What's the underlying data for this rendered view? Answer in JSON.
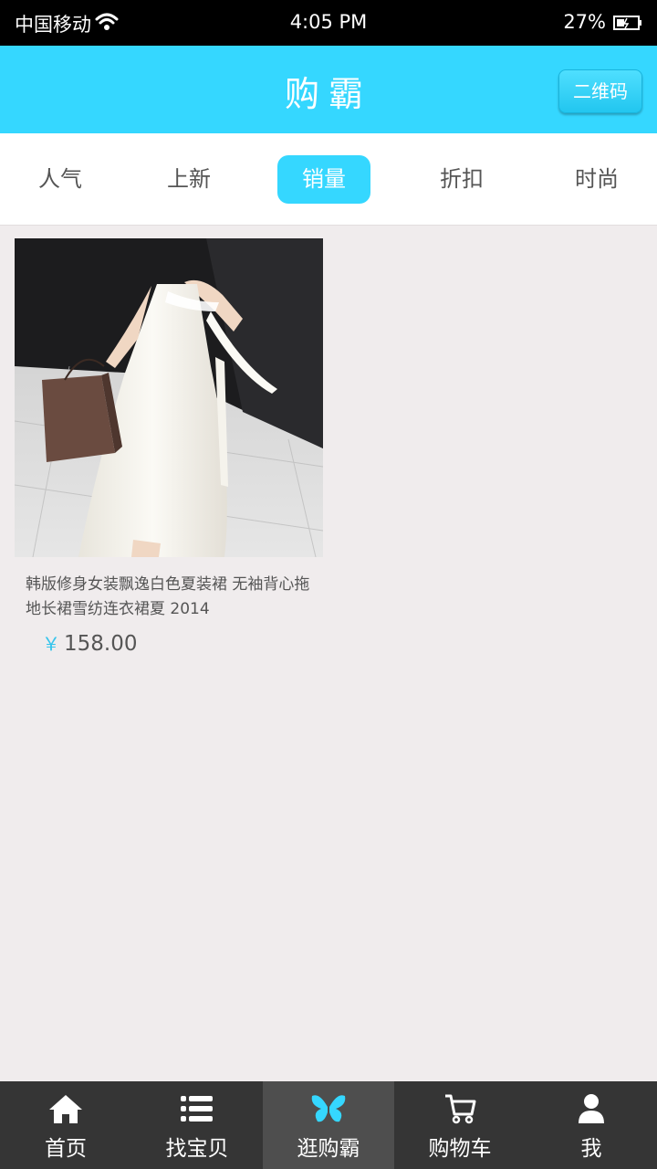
{
  "status_bar": {
    "carrier": "中国移动",
    "time": "4:05 PM",
    "battery": "27%"
  },
  "header": {
    "title": "购霸",
    "qr_button": "二维码"
  },
  "tabs": [
    {
      "label": "人气"
    },
    {
      "label": "上新"
    },
    {
      "label": "销量",
      "active": true
    },
    {
      "label": "折扣"
    },
    {
      "label": "时尚"
    }
  ],
  "products": [
    {
      "title": "韩版修身女装飘逸白色夏装裙 无袖背心拖地长裙雪纺连衣裙夏 2014",
      "currency": "￥",
      "price": "158.00"
    }
  ],
  "bottom_nav": [
    {
      "label": "首页",
      "icon": "home-icon"
    },
    {
      "label": "找宝贝",
      "icon": "list-icon"
    },
    {
      "label": "逛购霸",
      "icon": "butterfly-icon",
      "active": true
    },
    {
      "label": "购物车",
      "icon": "cart-icon"
    },
    {
      "label": "我",
      "icon": "user-icon"
    }
  ],
  "colors": {
    "accent": "#35d7ff",
    "background": "#f0eced",
    "nav_background": "#353535"
  }
}
